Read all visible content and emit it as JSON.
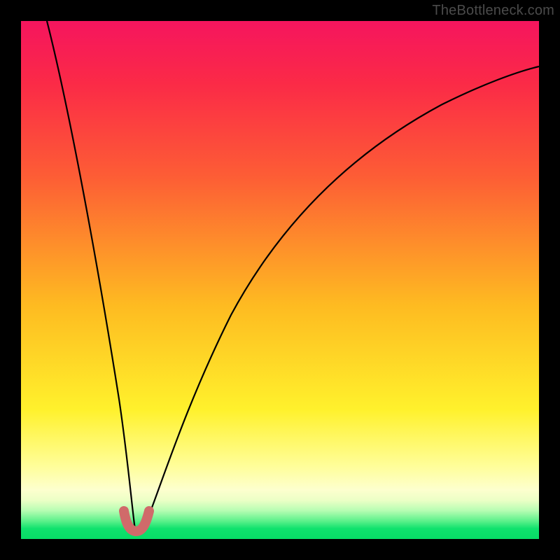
{
  "watermark": "TheBottleneck.com",
  "colors": {
    "background": "#000000",
    "curve_stroke": "#000000",
    "marker_stroke": "#d06a6a",
    "gradient_stops": [
      "#f5155e",
      "#fb2a47",
      "#fd5d35",
      "#febb21",
      "#fff12c",
      "#fffe9a",
      "#fdffce",
      "#ecffc6",
      "#b7fdb3",
      "#5df18b",
      "#0fe26d",
      "#07dd66"
    ]
  },
  "chart_data": {
    "type": "line",
    "title": "",
    "xlabel": "",
    "ylabel": "",
    "xlim": [
      0,
      100
    ],
    "ylim": [
      0,
      100
    ],
    "note": "Axes and tick marks are not shown in the image. x/y values are estimated from pixel position inside the 740×740 plot area (x left→right = 0→100, y bottom→top = 0→100). Two branches meeting near x≈22.",
    "series": [
      {
        "name": "left-branch",
        "x": [
          5.0,
          7.0,
          9.5,
          12.0,
          14.5,
          17.0,
          19.0,
          20.5,
          21.5,
          22.0
        ],
        "y": [
          100.0,
          84.0,
          67.0,
          51.0,
          35.5,
          21.0,
          10.5,
          4.5,
          2.0,
          1.5
        ]
      },
      {
        "name": "right-branch",
        "x": [
          22.0,
          24.0,
          27.0,
          31.0,
          36.0,
          43.0,
          52.0,
          62.0,
          74.0,
          88.0,
          100.0
        ],
        "y": [
          1.5,
          3.5,
          10.0,
          21.0,
          34.0,
          48.0,
          61.0,
          71.0,
          79.5,
          85.5,
          89.0
        ]
      }
    ],
    "markers": {
      "description": "Short thick salmon U-shaped marker segment at the curve minimum",
      "x": [
        19.8,
        20.6,
        21.4,
        22.2,
        23.0,
        23.8,
        24.6
      ],
      "y": [
        4.0,
        2.3,
        1.6,
        1.5,
        1.7,
        2.6,
        4.3
      ]
    }
  }
}
